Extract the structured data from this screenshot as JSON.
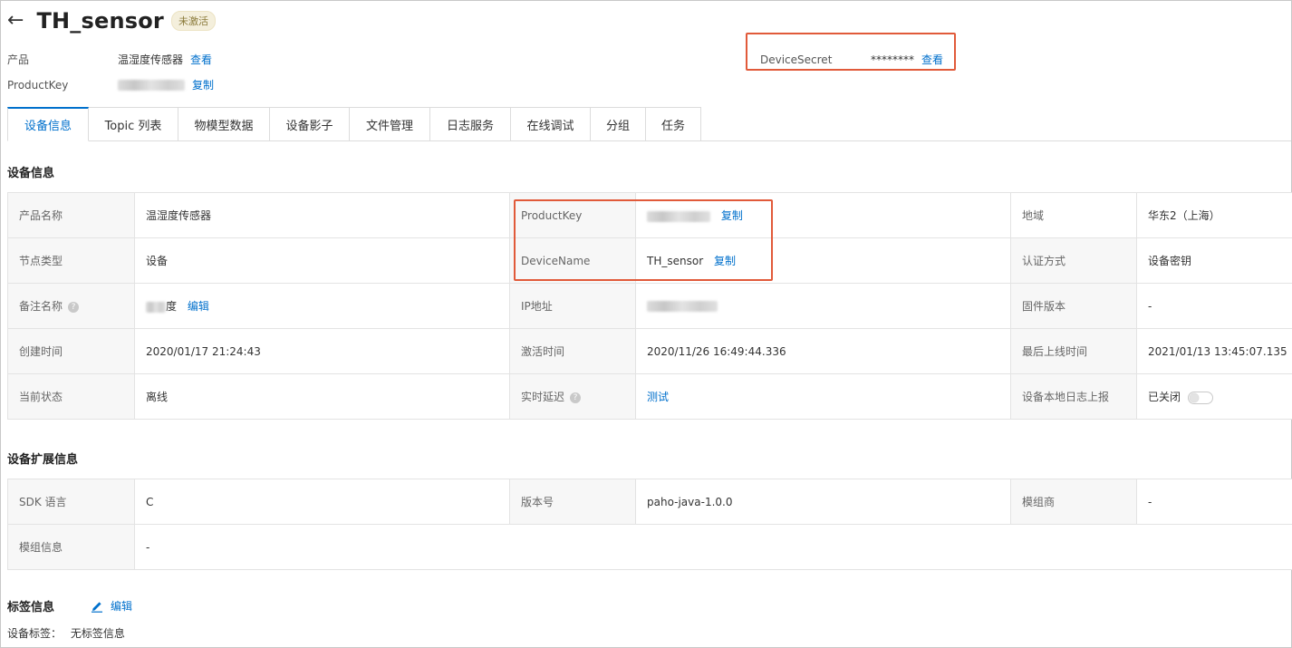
{
  "header": {
    "back_icon": "arrow-left-icon",
    "title": "TH_sensor",
    "status_badge": "未激活"
  },
  "meta": {
    "product_label": "产品",
    "product_value": "温湿度传感器",
    "product_action": "查看",
    "productkey_label": "ProductKey",
    "productkey_action": "复制",
    "devicesecret_label": "DeviceSecret",
    "devicesecret_value": "********",
    "devicesecret_action": "查看"
  },
  "tabs": [
    {
      "label": "设备信息",
      "active": true
    },
    {
      "label": "Topic 列表"
    },
    {
      "label": "物模型数据"
    },
    {
      "label": "设备影子"
    },
    {
      "label": "文件管理"
    },
    {
      "label": "日志服务"
    },
    {
      "label": "在线调试"
    },
    {
      "label": "分组"
    },
    {
      "label": "任务"
    }
  ],
  "device_info": {
    "title": "设备信息",
    "product_name_label": "产品名称",
    "product_name_value": "温湿度传感器",
    "productkey_label": "ProductKey",
    "productkey_action": "复制",
    "region_label": "地域",
    "region_value": "华东2（上海）",
    "node_type_label": "节点类型",
    "node_type_value": "设备",
    "devicename_label": "DeviceName",
    "devicename_value": "TH_sensor",
    "devicename_action": "复制",
    "auth_label": "认证方式",
    "auth_value": "设备密钥",
    "remark_label": "备注名称",
    "remark_value_suffix": "度",
    "remark_action": "编辑",
    "ip_label": "IP地址",
    "firmware_label": "固件版本",
    "firmware_value": "-",
    "created_label": "创建时间",
    "created_value": "2020/01/17 21:24:43",
    "activated_label": "激活时间",
    "activated_value": "2020/11/26 16:49:44.336",
    "last_online_label": "最后上线时间",
    "last_online_value": "2021/01/13 13:45:07.135",
    "status_label": "当前状态",
    "status_value": "离线",
    "latency_label": "实时延迟",
    "latency_action": "测试",
    "local_log_label": "设备本地日志上报",
    "local_log_value": "已关闭"
  },
  "ext_info": {
    "title": "设备扩展信息",
    "sdk_label": "SDK 语言",
    "sdk_value": "C",
    "version_label": "版本号",
    "version_value": "paho-java-1.0.0",
    "module_vendor_label": "模组商",
    "module_vendor_value": "-",
    "module_info_label": "模组信息",
    "module_info_value": "-"
  },
  "tags": {
    "title": "标签信息",
    "edit_action": "编辑",
    "device_tags_label": "设备标签：",
    "device_tags_value": "无标签信息"
  },
  "colors": {
    "link": "#0070cc",
    "highlight_border": "#e15a3a"
  }
}
